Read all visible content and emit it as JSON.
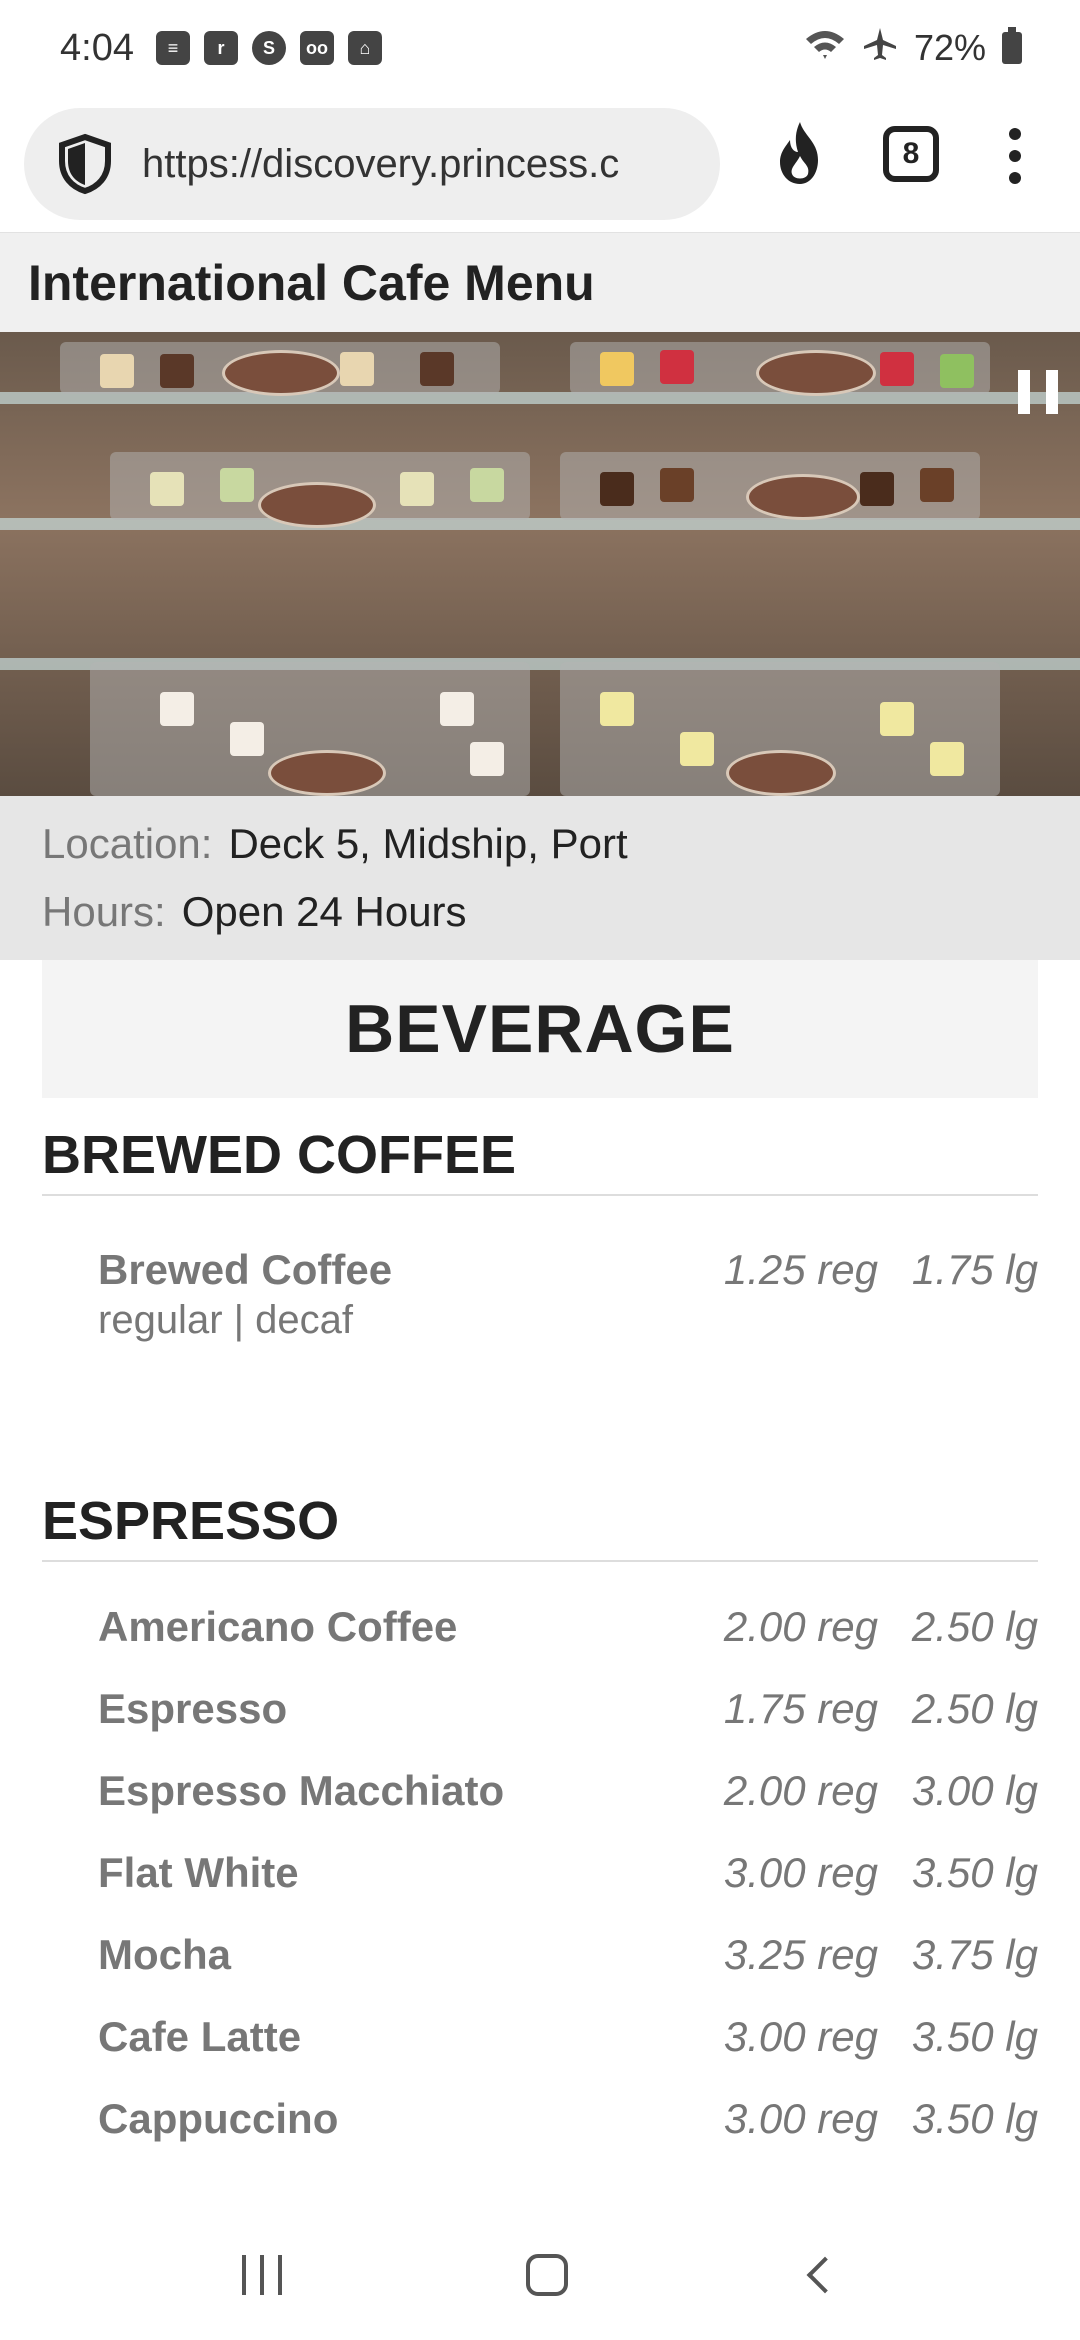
{
  "status_bar": {
    "time": "4:04",
    "battery": "72%",
    "icons": [
      "message-icon",
      "ring-icon",
      "app-icon",
      "voicemail-icon",
      "home-icon",
      "wifi-icon",
      "airplane-icon",
      "battery-icon"
    ]
  },
  "browser": {
    "url": "https://discovery.princess.c",
    "tab_count": "8"
  },
  "page": {
    "title": "International Cafe Menu",
    "location_label": "Location:",
    "location_value": "Deck 5, Midship, Port",
    "hours_label": "Hours:",
    "hours_value": "Open 24 Hours"
  },
  "menu": {
    "section_title": "BEVERAGE",
    "groups": [
      {
        "title": "BREWED COFFEE",
        "items": [
          {
            "name": "Brewed Coffee",
            "desc": "regular | decaf",
            "reg": "1.25 reg",
            "lg": "1.75 lg"
          }
        ]
      },
      {
        "title": "ESPRESSO",
        "items": [
          {
            "name": "Americano Coffee",
            "reg": "2.00 reg",
            "lg": "2.50 lg"
          },
          {
            "name": "Espresso",
            "reg": "1.75 reg",
            "lg": "2.50 lg"
          },
          {
            "name": "Espresso Macchiato",
            "reg": "2.00 reg",
            "lg": "3.00 lg"
          },
          {
            "name": "Flat White",
            "reg": "3.00 reg",
            "lg": "3.50 lg"
          },
          {
            "name": "Mocha",
            "reg": "3.25 reg",
            "lg": "3.75 lg"
          },
          {
            "name": "Cafe Latte",
            "reg": "3.00 reg",
            "lg": "3.50 lg"
          },
          {
            "name": "Cappuccino",
            "reg": "3.00 reg",
            "lg": "3.50 lg"
          }
        ]
      }
    ]
  },
  "colors": {
    "accent_text": "#222222",
    "muted_text": "#777777",
    "info_bg": "#e6e6e6",
    "section_bg": "#f4f4f4"
  }
}
